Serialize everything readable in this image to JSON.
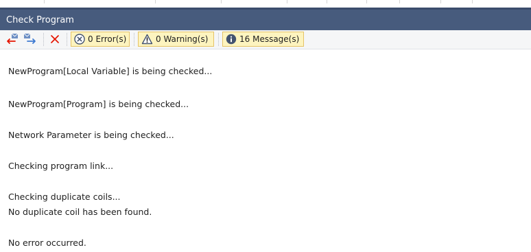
{
  "window": {
    "title": "Check Program"
  },
  "toolbar": {
    "icons": [
      "prev-message-icon",
      "next-message-icon",
      "clear-icon"
    ],
    "filters": [
      {
        "label": "0 Error(s)",
        "icon": "error-icon"
      },
      {
        "label": "0 Warning(s)",
        "icon": "warning-icon"
      },
      {
        "label": "16 Message(s)",
        "icon": "info-icon"
      }
    ]
  },
  "messages": [
    "NewProgram[Local Variable] is being checked...",
    "NewProgram[Program] is being checked...",
    "Network Parameter is being checked...",
    "Checking program link...",
    "Checking duplicate coils...",
    "No duplicate coil has been found.",
    "No error occurred."
  ],
  "colors": {
    "titlebar": "#475b7d",
    "filter_bg": "#fdf4bf",
    "filter_border": "#e5c365",
    "error_red": "#e51400",
    "arrow_blue": "#3d7ad1"
  }
}
